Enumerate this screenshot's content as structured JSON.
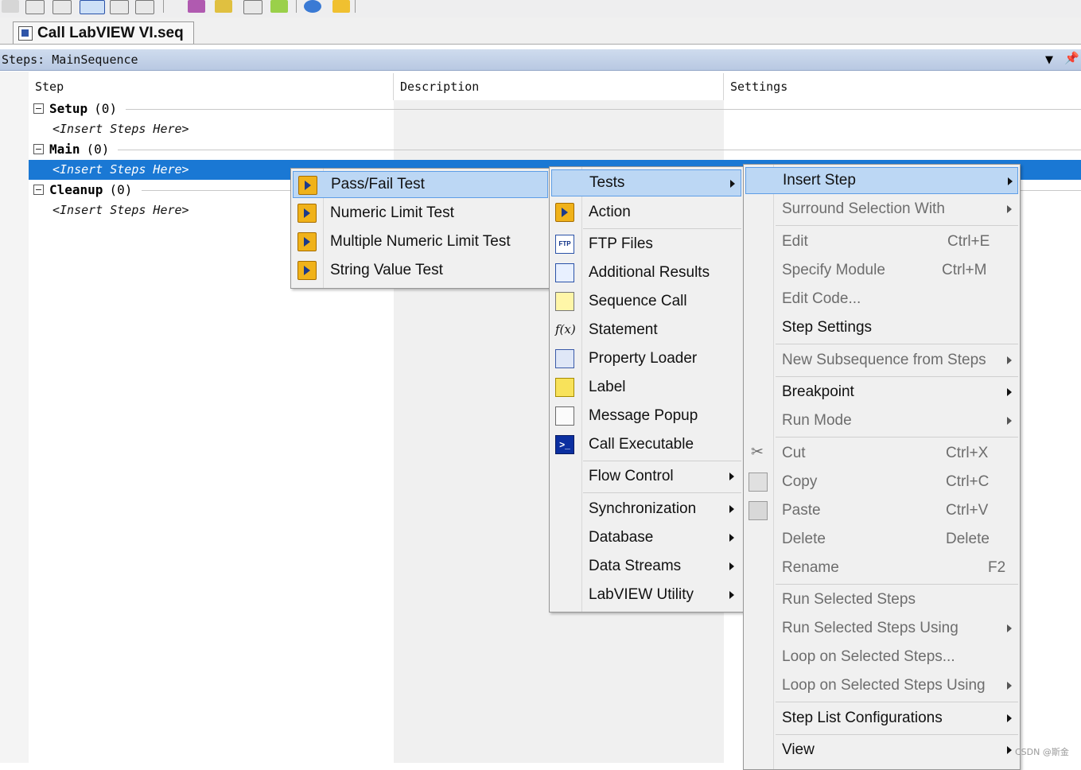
{
  "document_tab": {
    "title": "Call LabVIEW VI.seq",
    "icon": "vi-document-icon"
  },
  "steps_pane": {
    "title": "Steps: MainSequence",
    "dropdown_icon": "chevron-down-icon",
    "pin_icon": "pin-icon"
  },
  "grid": {
    "columns": [
      "Step",
      "Description",
      "Settings"
    ],
    "groups": [
      {
        "name": "Setup",
        "count": "(0)",
        "placeholder": "<Insert Steps Here>",
        "selected": false
      },
      {
        "name": "Main",
        "count": "(0)",
        "placeholder": "<Insert Steps Here>",
        "selected": true
      },
      {
        "name": "Cleanup",
        "count": "(0)",
        "placeholder": "<Insert Steps Here>",
        "selected": false
      }
    ]
  },
  "context_menu": {
    "items": [
      {
        "label": "Insert Step",
        "submenu": true,
        "highlighted": true
      },
      {
        "label": "Surround Selection With",
        "submenu": true,
        "disabled": true
      },
      {
        "label": "Edit",
        "shortcut": "Ctrl+E",
        "disabled": true
      },
      {
        "label": "Specify Module",
        "shortcut": "Ctrl+M",
        "disabled": true
      },
      {
        "label": "Edit Code...",
        "disabled": true
      },
      {
        "label": "Step Settings"
      },
      {
        "label": "New Subsequence from Steps",
        "submenu": true,
        "disabled": true
      },
      {
        "label": "Breakpoint",
        "submenu": true
      },
      {
        "label": "Run Mode",
        "submenu": true,
        "disabled": true
      },
      {
        "label": "Cut",
        "shortcut": "Ctrl+X",
        "disabled": true,
        "icon": "scissors-icon"
      },
      {
        "label": "Copy",
        "shortcut": "Ctrl+C",
        "disabled": true,
        "icon": "copy-icon"
      },
      {
        "label": "Paste",
        "shortcut": "Ctrl+V",
        "disabled": true,
        "icon": "paste-icon"
      },
      {
        "label": "Delete",
        "shortcut": "Delete",
        "disabled": true
      },
      {
        "label": "Rename",
        "shortcut": "F2",
        "disabled": true
      },
      {
        "label": "Run Selected Steps",
        "disabled": true
      },
      {
        "label": "Run Selected Steps Using",
        "submenu": true,
        "disabled": true
      },
      {
        "label": "Loop on Selected Steps...",
        "disabled": true
      },
      {
        "label": "Loop on Selected Steps Using",
        "submenu": true,
        "disabled": true
      },
      {
        "label": "Step List Configurations",
        "submenu": true
      },
      {
        "label": "View",
        "submenu": true
      }
    ]
  },
  "insert_step_menu": {
    "items": [
      {
        "label": "Tests",
        "submenu": true,
        "highlighted": true
      },
      {
        "label": "Action",
        "icon": "action-step-icon"
      },
      {
        "label": "FTP Files",
        "icon": "ftp-icon"
      },
      {
        "label": "Additional Results",
        "icon": "additional-results-icon"
      },
      {
        "label": "Sequence Call",
        "icon": "sequence-call-icon"
      },
      {
        "label": "Statement",
        "icon": "statement-fx-icon"
      },
      {
        "label": "Property Loader",
        "icon": "property-loader-icon"
      },
      {
        "label": "Label",
        "icon": "label-icon"
      },
      {
        "label": "Message Popup",
        "icon": "message-popup-icon"
      },
      {
        "label": "Call Executable",
        "icon": "call-executable-icon"
      },
      {
        "label": "Flow Control",
        "submenu": true
      },
      {
        "label": "Synchronization",
        "submenu": true
      },
      {
        "label": "Database",
        "submenu": true
      },
      {
        "label": "Data Streams",
        "submenu": true
      },
      {
        "label": "LabVIEW Utility",
        "submenu": true
      }
    ]
  },
  "tests_menu": {
    "items": [
      {
        "label": "Pass/Fail Test",
        "highlighted": true
      },
      {
        "label": "Numeric Limit Test"
      },
      {
        "label": "Multiple Numeric Limit Test"
      },
      {
        "label": "String Value Test"
      }
    ]
  },
  "watermark": "CSDN @斯金"
}
